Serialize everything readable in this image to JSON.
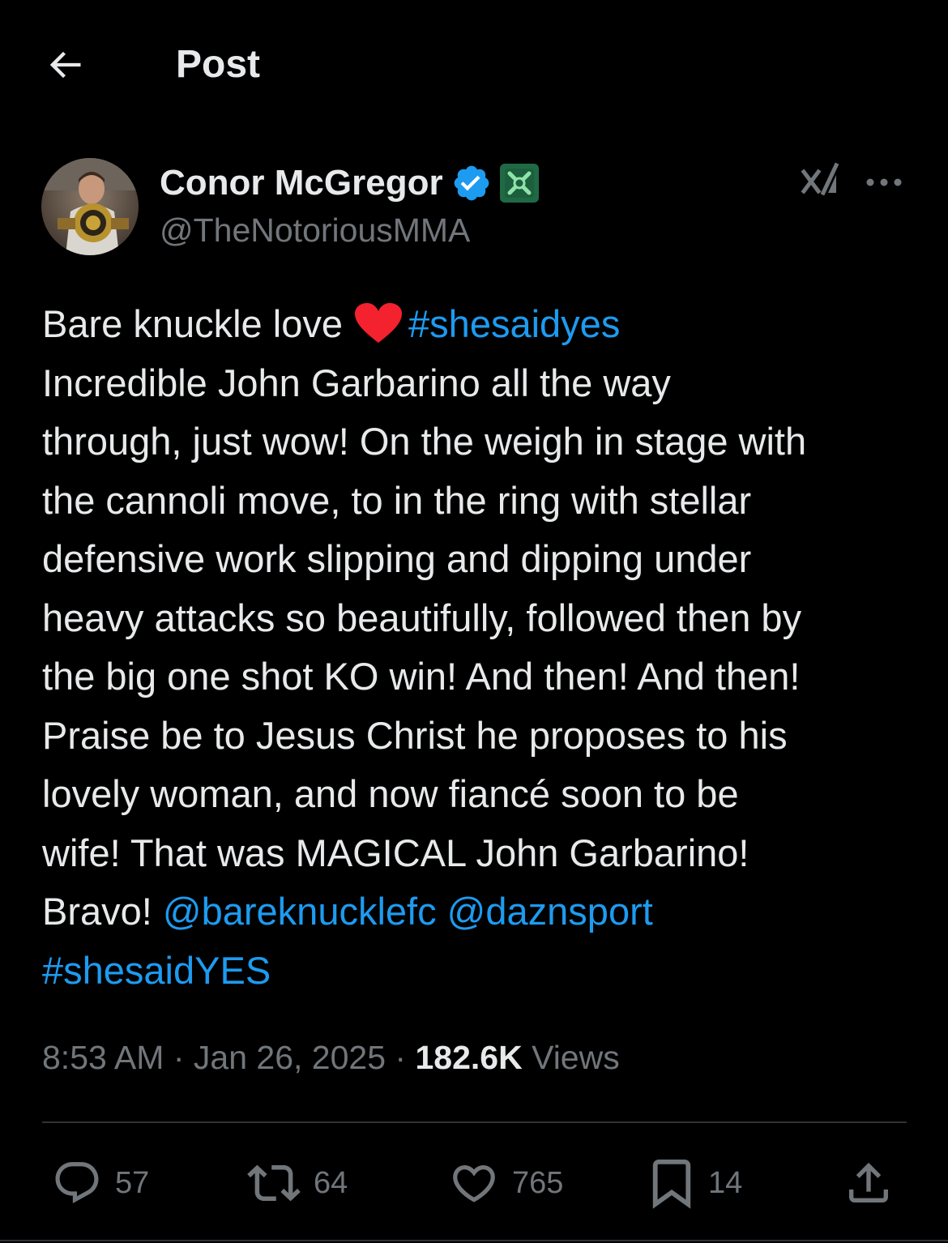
{
  "header": {
    "title": "Post"
  },
  "author": {
    "display_name": "Conor McGregor",
    "handle": "@TheNotoriousMMA"
  },
  "tweet": {
    "lines": [
      [
        "Bare knuckle love ",
        "#shesaidyes"
      ],
      [
        "Incredible John Garbarino all the way"
      ],
      [
        "through, just wow! On the weigh in stage with"
      ],
      [
        "the cannoli move, to in the ring with stellar"
      ],
      [
        "defensive work slipping and dipping under"
      ],
      [
        "heavy attacks so beautifully, followed then by"
      ],
      [
        "the big one shot KO win! And then! And then!"
      ],
      [
        "Praise be to Jesus Christ he proposes to his"
      ],
      [
        "lovely woman, and now fiancé soon to be"
      ],
      [
        "wife! That was MAGICAL John Garbarino!"
      ],
      [
        "Bravo! ",
        "@bareknucklefc",
        " ",
        "@daznsport"
      ],
      [
        "#shesaidYES"
      ]
    ],
    "line1_text": "Bare knuckle love",
    "hashtag1": "#shesaidyes",
    "line2": "Incredible John Garbarino all the way",
    "line3": "through, just wow! On the weigh in stage with",
    "line4": "the cannoli move, to in the ring with stellar",
    "line5": "defensive work slipping and dipping under",
    "line6": "heavy attacks so beautifully, followed then by",
    "line7": "the big one shot KO win! And then! And then!",
    "line8": "Praise be to Jesus Christ he proposes to his",
    "line9": "lovely woman, and now fiancé soon to be",
    "line10": "wife! That was MAGICAL John Garbarino!",
    "line11_text": "Bravo!",
    "mention1": "@bareknucklefc",
    "mention2": "@daznsport",
    "hashtag2": "#shesaidYES",
    "emoji": "heart-emoji"
  },
  "meta": {
    "time": "8:53 AM",
    "sep1": "·",
    "date": "Jan 26, 2025",
    "sep2": "·",
    "views_count": "182.6K",
    "views_label": "Views"
  },
  "actions": {
    "replies": "57",
    "reposts": "64",
    "likes": "765",
    "bookmarks": "14"
  },
  "icons": {
    "back": "back-arrow-icon",
    "verified": "verified-badge-icon",
    "affiliate": "affiliate-badge-icon",
    "grok": "grok-icon",
    "more": "more-icon",
    "reply": "reply-icon",
    "repost": "repost-icon",
    "like": "like-icon",
    "bookmark": "bookmark-icon",
    "share": "share-icon"
  },
  "colors": {
    "background": "#000000",
    "text": "#e7e9ea",
    "secondary": "#71767b",
    "link": "#1d9bf0",
    "heart": "#f4212e",
    "divider": "#2f3336"
  }
}
